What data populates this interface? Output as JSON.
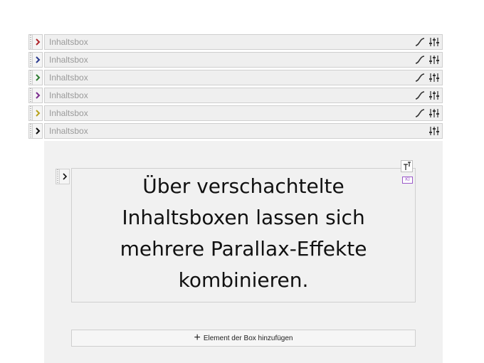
{
  "rows": [
    {
      "label": "Inhaltsbox",
      "chevron_color": "#b0262c",
      "has_curve": true
    },
    {
      "label": "Inhaltsbox",
      "chevron_color": "#2b3b8f",
      "has_curve": true
    },
    {
      "label": "Inhaltsbox",
      "chevron_color": "#2e7d32",
      "has_curve": true
    },
    {
      "label": "Inhaltsbox",
      "chevron_color": "#7b2d8e",
      "has_curve": true
    },
    {
      "label": "Inhaltsbox",
      "chevron_color": "#b8a21e",
      "has_curve": true
    },
    {
      "label": "Inhaltsbox",
      "chevron_color": "#111111",
      "has_curve": false
    }
  ],
  "content": {
    "line1": "Über verschachtelte",
    "line2": "Inhaltsboxen lassen sich",
    "line3": "mehrere Parallax-Effekte",
    "line4": "kombinieren."
  },
  "ki_badge": "KI",
  "add_button": {
    "label": "Element der Box hinzufügen"
  },
  "icons": {
    "curve": "parallax-curve-icon",
    "settings": "sliders-icon",
    "text": "text-format-icon",
    "add": "plus-icon",
    "toggle": "chevron-right-icon"
  }
}
